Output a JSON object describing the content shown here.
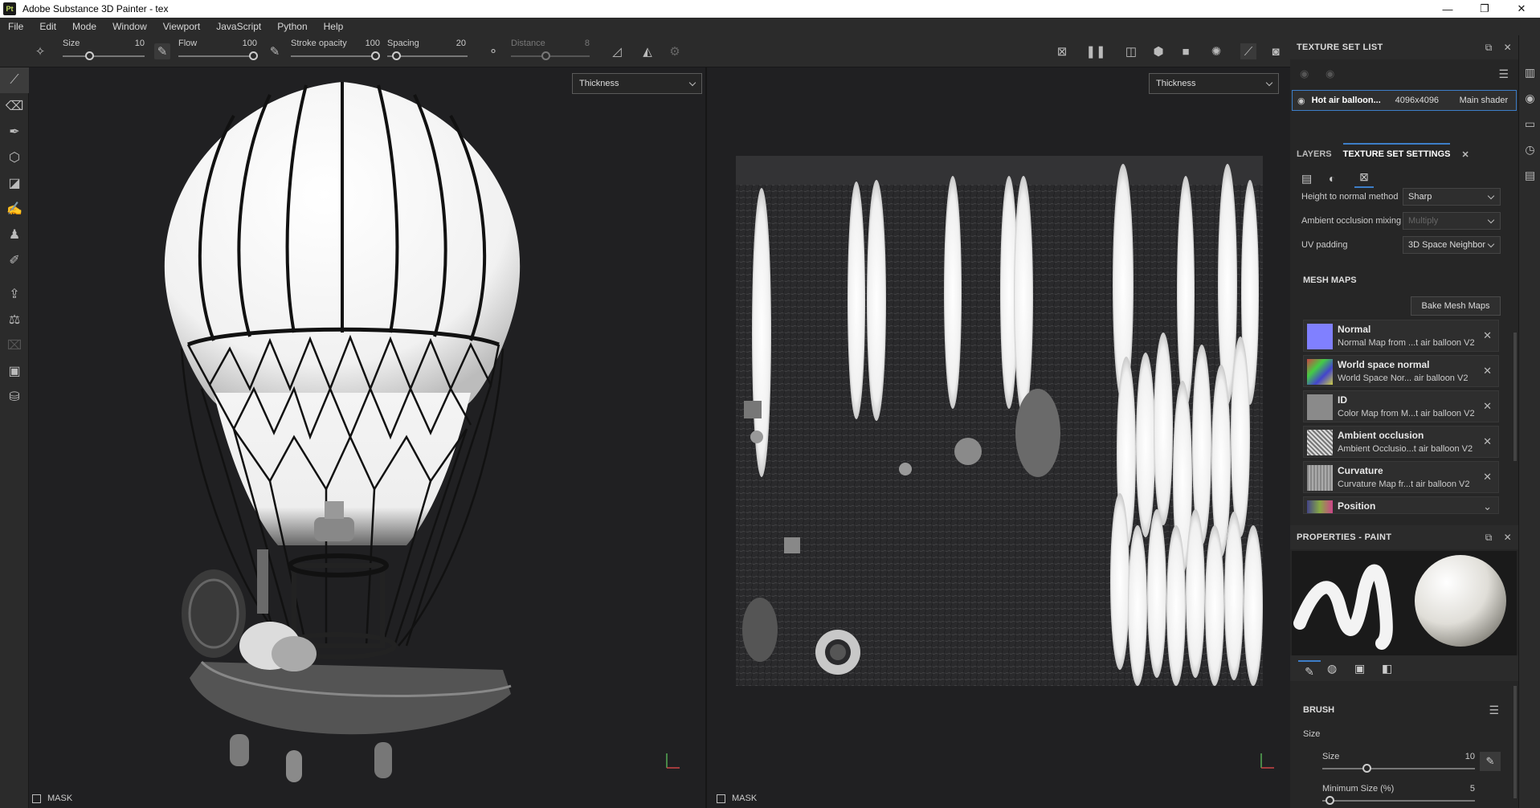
{
  "app": {
    "title": "Adobe Substance 3D Painter - tex",
    "logo": "Pt"
  },
  "window_controls": [
    "—",
    "❐",
    "✕"
  ],
  "menu": [
    "File",
    "Edit",
    "Mode",
    "Window",
    "Viewport",
    "JavaScript",
    "Python",
    "Help"
  ],
  "toolbar": {
    "size_label": "Size",
    "size_value": "10",
    "flow_label": "Flow",
    "flow_value": "100",
    "stroke_opacity_label": "Stroke opacity",
    "stroke_opacity_value": "100",
    "spacing_label": "Spacing",
    "spacing_value": "20",
    "distance_label": "Distance",
    "distance_value": "8"
  },
  "viewports": {
    "left_channel": "Thickness",
    "right_channel": "Thickness",
    "mask_label_left": "MASK",
    "mask_label_right": "MASK"
  },
  "texture_set_list": {
    "header": "TEXTURE SET LIST",
    "item_name": "Hot air balloon...",
    "item_resolution": "4096x4096",
    "item_shader": "Main shader"
  },
  "tabs": {
    "layers": "LAYERS",
    "texture_set_settings": "TEXTURE SET SETTINGS"
  },
  "settings": {
    "height_to_normal_label": "Height to normal method",
    "height_to_normal_value": "Sharp",
    "ao_mixing_label": "Ambient occlusion mixing",
    "ao_mixing_value": "Multiply",
    "uv_padding_label": "UV padding",
    "uv_padding_value": "3D Space Neighbor"
  },
  "mesh_maps": {
    "header": "MESH MAPS",
    "bake_button": "Bake Mesh Maps",
    "items": [
      {
        "name": "Normal",
        "sub": "Normal Map from ...t air balloon V2"
      },
      {
        "name": "World space normal",
        "sub": "World Space Nor... air balloon V2"
      },
      {
        "name": "ID",
        "sub": "Color Map from M...t air balloon V2"
      },
      {
        "name": "Ambient occlusion",
        "sub": "Ambient Occlusio...t air balloon V2"
      },
      {
        "name": "Curvature",
        "sub": "Curvature Map fr...t air balloon V2"
      },
      {
        "name": "Position",
        "sub": ""
      }
    ]
  },
  "properties": {
    "header": "PROPERTIES - PAINT",
    "brush_header": "BRUSH",
    "size_section": "Size",
    "size_label": "Size",
    "size_value": "10",
    "min_size_label": "Minimum Size (%)",
    "min_size_value": "5"
  },
  "colors": {
    "accent": "#3d7ec8",
    "panel_bg": "#262626",
    "viewport_bg": "#202022"
  }
}
